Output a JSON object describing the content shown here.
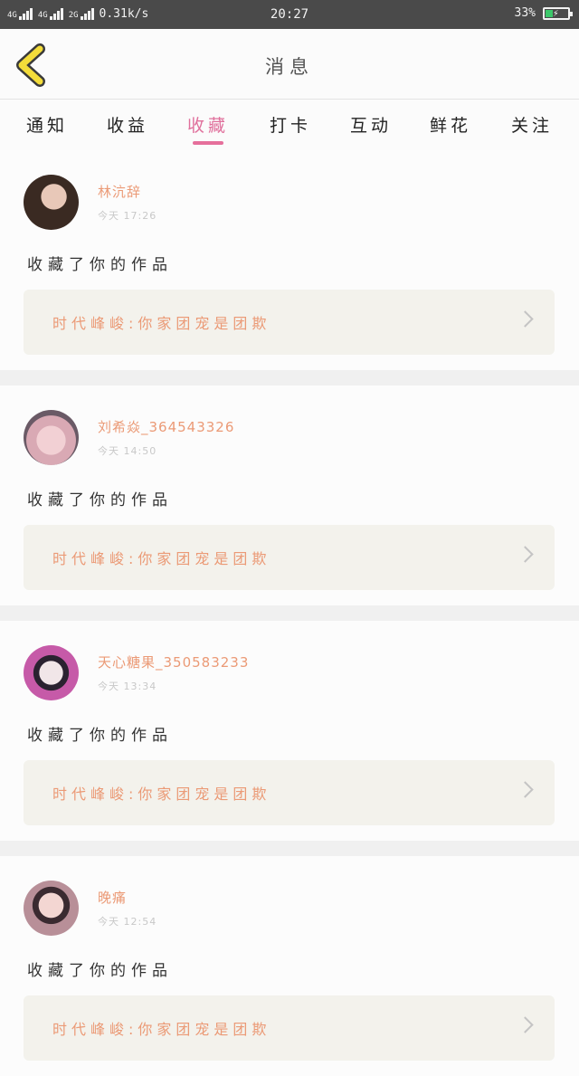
{
  "status_bar": {
    "signal_1": "4G",
    "signal_2": "4G",
    "signal_3": "2G",
    "speed": "0.31k/s",
    "time": "20:27",
    "battery_percent": "33%",
    "battery_level": 0.33
  },
  "header": {
    "title": "消息",
    "back_icon": "chevron-left-icon"
  },
  "tabs": [
    {
      "label": "通知"
    },
    {
      "label": "收益"
    },
    {
      "label": "收藏",
      "active": true
    },
    {
      "label": "打卡"
    },
    {
      "label": "互动"
    },
    {
      "label": "鲜花"
    },
    {
      "label": "关注"
    }
  ],
  "colors": {
    "accent_pink": "#e56f9b",
    "username_orange": "#eb9a76",
    "box_bg": "#f3f2ec"
  },
  "messages": [
    {
      "username": "林沆辞",
      "time": "今天 17:26",
      "action": "收藏了你的作品",
      "work_title": "时代峰峻:你家团宠是团欺"
    },
    {
      "username": "刘希焱_364543326",
      "time": "今天 14:50",
      "action": "收藏了你的作品",
      "work_title": "时代峰峻:你家团宠是团欺"
    },
    {
      "username": "天心糖果_350583233",
      "time": "今天 13:34",
      "action": "收藏了你的作品",
      "work_title": "时代峰峻:你家团宠是团欺"
    },
    {
      "username": "晚痛",
      "time": "今天 12:54",
      "action": "收藏了你的作品",
      "work_title": "时代峰峻:你家团宠是团欺"
    }
  ]
}
